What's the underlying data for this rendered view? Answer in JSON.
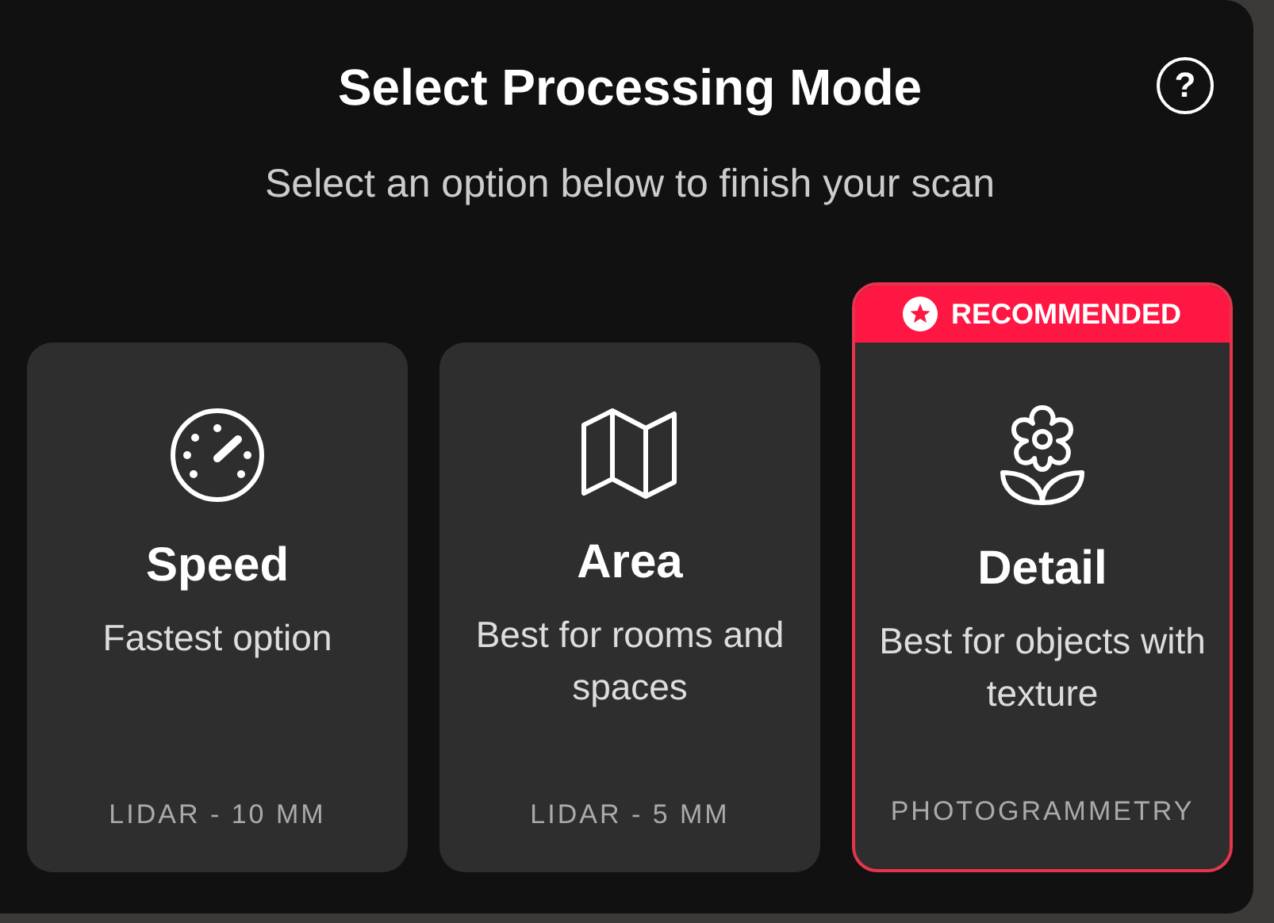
{
  "dialog": {
    "title": "Select Processing Mode",
    "help_button": "?",
    "subtitle": "Select an option below to finish your scan"
  },
  "options": [
    {
      "title": "Speed",
      "description": "Fastest option",
      "spec": "LIDAR - 10 MM",
      "recommended": false
    },
    {
      "title": "Area",
      "description": "Best for rooms and spaces",
      "spec": "LIDAR - 5 MM",
      "recommended": false
    },
    {
      "title": "Detail",
      "description": "Best for objects with texture",
      "spec": "PHOTOGRAMMETRY",
      "recommended": true,
      "badge": "RECOMMENDED"
    }
  ]
}
